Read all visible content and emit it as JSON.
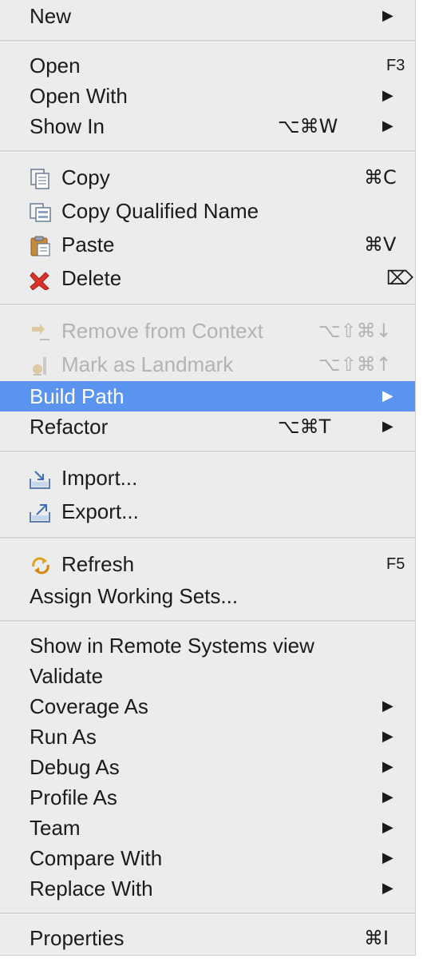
{
  "menu": {
    "new": {
      "label": "New"
    },
    "open": {
      "label": "Open",
      "shortcut": "F3"
    },
    "open_with": {
      "label": "Open With"
    },
    "show_in": {
      "label": "Show In",
      "shortcut": "⌥⌘W"
    },
    "copy": {
      "label": "Copy",
      "shortcut": "⌘C",
      "icon": "copy-icon"
    },
    "copy_qualified": {
      "label": "Copy Qualified Name",
      "icon": "copy-qualified-name-icon"
    },
    "paste": {
      "label": "Paste",
      "shortcut": "⌘V",
      "icon": "paste-icon"
    },
    "delete": {
      "label": "Delete",
      "shortcut": "⌦",
      "icon": "delete-icon"
    },
    "remove_context": {
      "label": "Remove from Context",
      "shortcut": "⌥⇧⌘↓",
      "icon": "remove-context-icon"
    },
    "mark_landmark": {
      "label": "Mark as Landmark",
      "shortcut": "⌥⇧⌘↑",
      "icon": "landmark-icon"
    },
    "build_path": {
      "label": "Build Path"
    },
    "refactor": {
      "label": "Refactor",
      "shortcut": "⌥⌘T"
    },
    "import": {
      "label": "Import...",
      "icon": "import-icon"
    },
    "export": {
      "label": "Export...",
      "icon": "export-icon"
    },
    "refresh": {
      "label": "Refresh",
      "shortcut": "F5",
      "icon": "refresh-icon"
    },
    "assign_working_sets": {
      "label": "Assign Working Sets..."
    },
    "show_remote": {
      "label": "Show in Remote Systems view"
    },
    "validate": {
      "label": "Validate"
    },
    "coverage_as": {
      "label": "Coverage As"
    },
    "run_as": {
      "label": "Run As"
    },
    "debug_as": {
      "label": "Debug As"
    },
    "profile_as": {
      "label": "Profile As"
    },
    "team": {
      "label": "Team"
    },
    "compare_with": {
      "label": "Compare With"
    },
    "replace_with": {
      "label": "Replace With"
    },
    "properties": {
      "label": "Properties",
      "shortcut": "⌘I"
    },
    "submenu_arrow": "▶"
  },
  "colors": {
    "menu_bg": "#ececec",
    "highlight": "#5b93f0",
    "text": "#1b1b1b",
    "disabled_text": "#b3b3b3",
    "delete_red": "#d9342b"
  }
}
